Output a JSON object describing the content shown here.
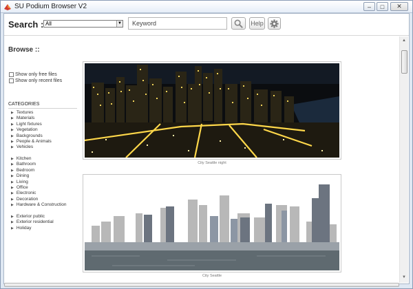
{
  "window": {
    "title": "SU Podium Browser V2",
    "buttons": {
      "minimize": "–",
      "maximize": "□",
      "close": "✕"
    }
  },
  "toolbar": {
    "search_label": "Search ::",
    "category_value": "All",
    "keyword_value": "Keyword",
    "help_label": "Help",
    "icons": {
      "search": "magnifier-icon",
      "settings": "gear-icon"
    }
  },
  "sidebar": {
    "browse_title": "Browse ::",
    "filters": [
      {
        "label": "Show only free files",
        "checked": false
      },
      {
        "label": "Show only recent files",
        "checked": false
      }
    ],
    "categories_title": "CATEGORIES",
    "groups": [
      [
        "Textures",
        "Materials",
        "Light fixtures",
        "Vegetation",
        "Backgrounds",
        "People & Animals",
        "Vehicles"
      ],
      [
        "Kitchen",
        "Bathroom",
        "Bedroom",
        "Dining",
        "Living",
        "Office",
        "Electronic",
        "Decoration",
        "Hardware & Construction"
      ],
      [
        "Exterior public",
        "Exterior residential",
        "Holiday"
      ]
    ]
  },
  "content": {
    "items": [
      {
        "caption": "City Seattle night"
      },
      {
        "caption": "City Seattle"
      }
    ]
  },
  "colors": {
    "window_frame": "#dfe8f3",
    "night_sky": "#0b0d10",
    "day_sky": "#ffffff",
    "water": "#5f6a70"
  }
}
